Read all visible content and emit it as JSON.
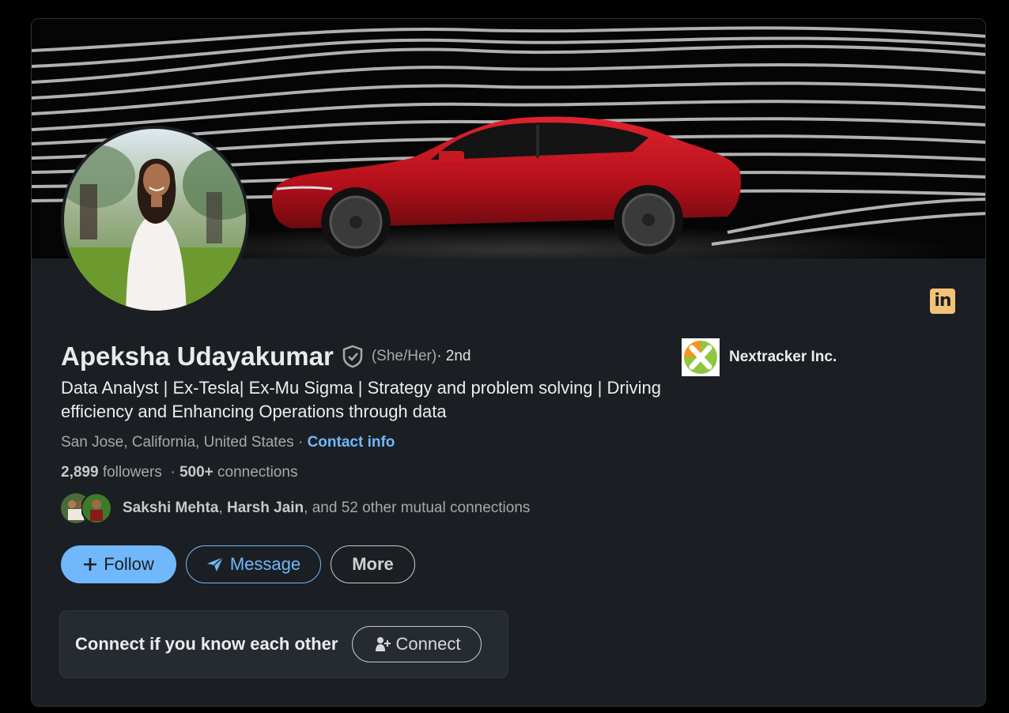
{
  "profile": {
    "name": "Apeksha Udayakumar",
    "pronouns": "(She/Her)",
    "degree": " · 2nd",
    "headline": "Data Analyst | Ex-Tesla| Ex-Mu Sigma | Strategy and problem solving | Driving efficiency and Enhancing Operations through data",
    "location": "San Jose, California, United States",
    "location_separator": " · ",
    "contact_label": "Contact info",
    "followers_count": "2,899",
    "followers_label": " followers",
    "connections_sep": "  · ",
    "connections_count": "500+",
    "connections_label": " connections"
  },
  "mutual": {
    "name1": "Sakshi Mehta",
    "sep1": ", ",
    "name2": "Harsh Jain",
    "rest": ", and 52 other mutual connections"
  },
  "company": {
    "name": "Nextracker Inc.",
    "logo_icon": "nextracker-logo"
  },
  "badge": {
    "text": "in",
    "color": "#f3c277"
  },
  "actions": {
    "follow_label": "Follow",
    "message_label": "Message",
    "more_label": "More"
  },
  "connect_prompt": {
    "text": "Connect if you know each other",
    "button_label": "Connect"
  },
  "colors": {
    "accent": "#71b7fb",
    "card_bg": "#1b1f23",
    "banner_car": "#c1121f"
  }
}
